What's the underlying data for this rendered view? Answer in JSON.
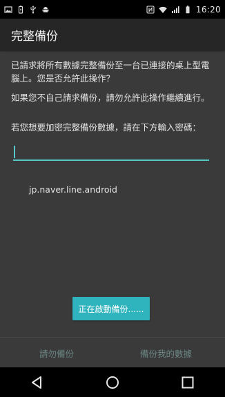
{
  "status_bar": {
    "time": "16:20",
    "icons_left": [
      "gallery-icon",
      "battery-saver-icon",
      "usb-icon",
      "android-icon"
    ],
    "icons_right": [
      "nfc-icon",
      "wifi-icon",
      "signal-icon",
      "battery-icon"
    ]
  },
  "title": "完整備份",
  "message": {
    "line1": "已請求將所有數據完整備份至一台已連接的桌上型電腦上。您是否允許此操作？",
    "line2": "如果您不自己請求備份，請勿允許此操作繼續進行。",
    "line3": "若您想要加密完整備份數據，請在下方輸入密碼："
  },
  "password": {
    "value": "",
    "placeholder": ""
  },
  "package_name": "jp.naver.line.android",
  "progress_button_label": "正在啟動備份......",
  "actions": {
    "deny_label": "請勿備份",
    "allow_label": "備份我的數據"
  },
  "colors": {
    "accent": "#56c6c9",
    "button": "#2fb3bd",
    "disabled_text": "#6a8583",
    "background": "#3a3a3a"
  }
}
